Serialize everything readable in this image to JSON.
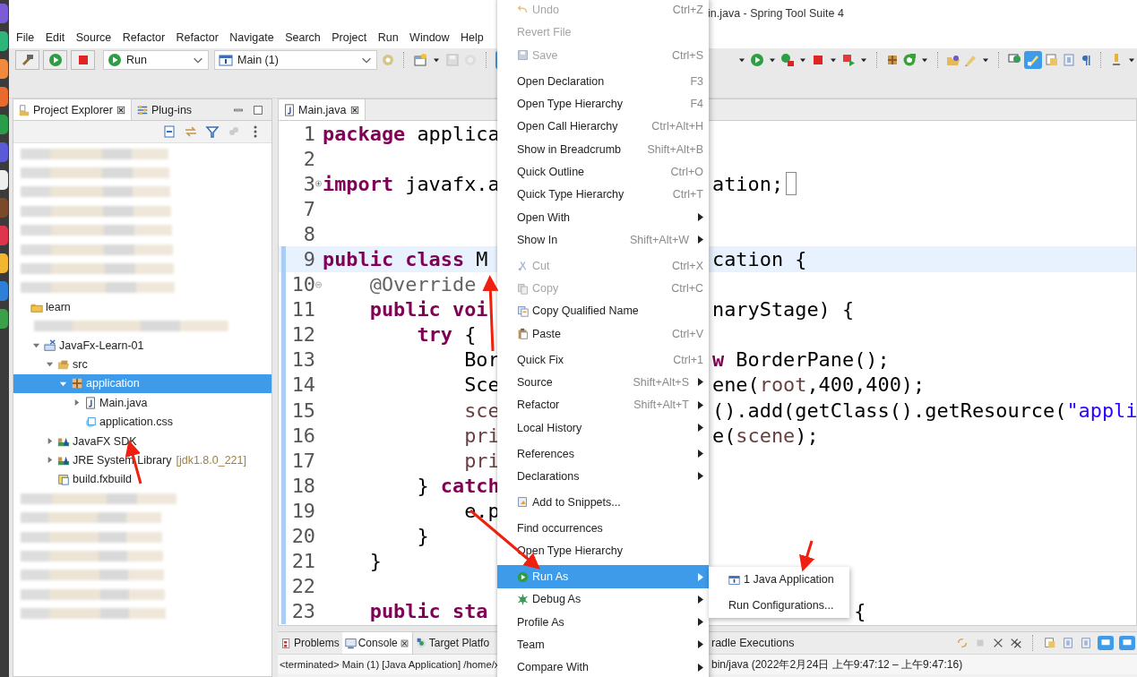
{
  "window": {
    "title": "in.java - Spring Tool Suite 4"
  },
  "menu_bar": [
    "File",
    "Edit",
    "Source",
    "Refactor",
    "Refactor",
    "Navigate",
    "Search",
    "Project",
    "Run",
    "Window",
    "Help"
  ],
  "toolbar": {
    "run_combo": "Run",
    "launch_combo": "Main (1)",
    "toggles": [
      {
        "selected": true
      },
      {
        "selected": true
      }
    ]
  },
  "project_explorer": {
    "tabs": [
      {
        "label": "Project Explorer",
        "selected": true,
        "closable": true
      },
      {
        "label": "Plug-ins",
        "selected": false,
        "closable": false
      }
    ],
    "tree": [
      {
        "kind": "blurred"
      },
      {
        "kind": "blurred"
      },
      {
        "kind": "blurred"
      },
      {
        "kind": "blurred"
      },
      {
        "kind": "blurred"
      },
      {
        "kind": "blurred"
      },
      {
        "kind": "blurred"
      },
      {
        "kind": "blurred"
      },
      {
        "kind": "folder",
        "label": "learn",
        "selected": false,
        "children": [
          {
            "kind": "blurred"
          },
          {
            "kind": "project",
            "label": "JavaFx-Learn-01",
            "expanded": true,
            "selected": false,
            "children": [
              {
                "kind": "source-folder",
                "label": "src",
                "expanded": true,
                "selected": false,
                "children": [
                  {
                    "kind": "package",
                    "label": "application",
                    "expanded": true,
                    "selected": true,
                    "children": [
                      {
                        "kind": "java-file",
                        "label": "Main.java",
                        "expanded": false,
                        "selected": false
                      },
                      {
                        "kind": "css-file",
                        "label": "application.css",
                        "selected": false
                      }
                    ]
                  }
                ]
              },
              {
                "kind": "library",
                "label": "JavaFX SDK",
                "expanded": false,
                "selected": false
              },
              {
                "kind": "library",
                "label": "JRE System Library",
                "decoration": "[jdk1.8.0_221]",
                "expanded": false,
                "selected": false
              },
              {
                "kind": "build-file",
                "label": "build.fxbuild",
                "selected": false
              }
            ]
          }
        ]
      },
      {
        "kind": "blurred"
      },
      {
        "kind": "blurred"
      },
      {
        "kind": "blurred"
      },
      {
        "kind": "blurred"
      },
      {
        "kind": "blurred"
      },
      {
        "kind": "blurred"
      },
      {
        "kind": "blurred"
      }
    ]
  },
  "editor": {
    "tab": {
      "label": "Main.java",
      "closable": true
    },
    "lines": [
      {
        "number": "1",
        "current": false,
        "scope": false,
        "left": [
          {
            "text": "package",
            "kind": "keyword"
          },
          {
            "text": " applica",
            "kind": "plain"
          }
        ]
      },
      {
        "number": "2",
        "current": false,
        "scope": false
      },
      {
        "number": "3",
        "current": false,
        "scope": false,
        "folded": true,
        "left": [
          {
            "text": "import",
            "kind": "keyword"
          },
          {
            "text": " javafx.a",
            "kind": "plain"
          }
        ],
        "right": [
          {
            "text": "ation;",
            "kind": "plain"
          }
        ],
        "bracket_box": true
      },
      {
        "number": "7",
        "current": false,
        "scope": false
      },
      {
        "number": "8",
        "current": false,
        "scope": false
      },
      {
        "number": "9",
        "current": true,
        "scope": true,
        "left": [
          {
            "text": "public class",
            "kind": "keyword"
          },
          {
            "text": " M",
            "kind": "plain"
          }
        ],
        "right": [
          {
            "text": "cation {",
            "kind": "plain"
          }
        ]
      },
      {
        "number": "10",
        "current": false,
        "scope": true,
        "folded": false,
        "left": [
          {
            "text": "    @Override",
            "kind": "annotation"
          }
        ]
      },
      {
        "number": "11",
        "current": false,
        "scope": true,
        "left": [
          {
            "text": "    public voi",
            "kind": "keyword"
          }
        ],
        "right": [
          {
            "text": "naryStage) {",
            "kind": "plain"
          }
        ]
      },
      {
        "number": "12",
        "current": false,
        "scope": true,
        "left": [
          {
            "text": "        try",
            "kind": "keyword"
          },
          {
            "text": " {",
            "kind": "plain"
          }
        ]
      },
      {
        "number": "13",
        "current": false,
        "scope": true,
        "left": [
          {
            "text": "            Bor",
            "kind": "plain"
          }
        ],
        "right": [
          {
            "text": "w",
            "kind": "keyword"
          },
          {
            "text": " BorderPane();",
            "kind": "plain"
          }
        ]
      },
      {
        "number": "14",
        "current": false,
        "scope": true,
        "left": [
          {
            "text": "            Sce",
            "kind": "plain"
          }
        ],
        "right": [
          {
            "text": "ene(",
            "kind": "plain"
          },
          {
            "text": "root",
            "kind": "variable"
          },
          {
            "text": ",400,400);",
            "kind": "plain"
          }
        ]
      },
      {
        "number": "15",
        "current": false,
        "scope": true,
        "left": [
          {
            "text": "            sce",
            "kind": "variable"
          }
        ],
        "right": [
          {
            "text": "().add(getClass().getResource(",
            "kind": "plain"
          },
          {
            "text": "\"appli",
            "kind": "string"
          }
        ]
      },
      {
        "number": "16",
        "current": false,
        "scope": true,
        "left": [
          {
            "text": "            pri",
            "kind": "variable"
          }
        ],
        "right": [
          {
            "text": "e(",
            "kind": "plain"
          },
          {
            "text": "scene",
            "kind": "variable"
          },
          {
            "text": ");",
            "kind": "plain"
          }
        ]
      },
      {
        "number": "17",
        "current": false,
        "scope": true,
        "left": [
          {
            "text": "            pri",
            "kind": "variable"
          }
        ]
      },
      {
        "number": "18",
        "current": false,
        "scope": true,
        "left": [
          {
            "text": "        }",
            "kind": "plain"
          },
          {
            "text": " catch",
            "kind": "keyword"
          }
        ]
      },
      {
        "number": "19",
        "current": false,
        "scope": true,
        "left": [
          {
            "text": "            e.p",
            "kind": "plain"
          }
        ]
      },
      {
        "number": "20",
        "current": false,
        "scope": true,
        "left": [
          {
            "text": "        }",
            "kind": "plain"
          }
        ]
      },
      {
        "number": "21",
        "current": false,
        "scope": true,
        "left": [
          {
            "text": "    }",
            "kind": "plain"
          }
        ]
      },
      {
        "number": "22",
        "current": false,
        "scope": true
      },
      {
        "number": "23",
        "current": false,
        "scope": true,
        "left": [
          {
            "text": "    public sta",
            "kind": "keyword"
          }
        ],
        "right": [
          {
            "text": "            {",
            "kind": "plain"
          }
        ]
      }
    ]
  },
  "context_menu": {
    "items": [
      {
        "kind": "item",
        "label": "Undo",
        "shortcut": "Ctrl+Z",
        "disabled": true,
        "selected": false,
        "submenu": false
      },
      {
        "kind": "item",
        "label": "Revert File",
        "disabled": true,
        "selected": false,
        "submenu": false
      },
      {
        "kind": "item",
        "label": "Save",
        "shortcut": "Ctrl+S",
        "disabled": true,
        "selected": false,
        "submenu": false
      },
      {
        "kind": "separator"
      },
      {
        "kind": "item",
        "label": "Open Declaration",
        "shortcut": "F3",
        "disabled": false,
        "selected": false,
        "submenu": false
      },
      {
        "kind": "item",
        "label": "Open Type Hierarchy",
        "shortcut": "F4",
        "disabled": false,
        "selected": false,
        "submenu": false
      },
      {
        "kind": "item",
        "label": "Open Call Hierarchy",
        "shortcut": "Ctrl+Alt+H",
        "disabled": false,
        "selected": false,
        "submenu": false
      },
      {
        "kind": "item",
        "label": "Show in Breadcrumb",
        "shortcut": "Shift+Alt+B",
        "disabled": false,
        "selected": false,
        "submenu": false
      },
      {
        "kind": "item",
        "label": "Quick Outline",
        "shortcut": "Ctrl+O",
        "disabled": false,
        "selected": false,
        "submenu": false
      },
      {
        "kind": "item",
        "label": "Quick Type Hierarchy",
        "shortcut": "Ctrl+T",
        "disabled": false,
        "selected": false,
        "submenu": false
      },
      {
        "kind": "item",
        "label": "Open With",
        "disabled": false,
        "selected": false,
        "submenu": true
      },
      {
        "kind": "item",
        "label": "Show In",
        "shortcut": "Shift+Alt+W",
        "disabled": false,
        "selected": false,
        "submenu": true
      },
      {
        "kind": "separator"
      },
      {
        "kind": "item",
        "label": "Cut",
        "shortcut": "Ctrl+X",
        "disabled": true,
        "selected": false,
        "submenu": false
      },
      {
        "kind": "item",
        "label": "Copy",
        "shortcut": "Ctrl+C",
        "disabled": true,
        "selected": false,
        "submenu": false
      },
      {
        "kind": "item",
        "label": "Copy Qualified Name",
        "disabled": false,
        "selected": false,
        "submenu": false
      },
      {
        "kind": "item",
        "label": "Paste",
        "shortcut": "Ctrl+V",
        "disabled": false,
        "selected": false,
        "submenu": false
      },
      {
        "kind": "separator"
      },
      {
        "kind": "item",
        "label": "Quick Fix",
        "shortcut": "Ctrl+1",
        "disabled": false,
        "selected": false,
        "submenu": false
      },
      {
        "kind": "item",
        "label": "Source",
        "shortcut": "Shift+Alt+S",
        "disabled": false,
        "selected": false,
        "submenu": true
      },
      {
        "kind": "item",
        "label": "Refactor",
        "shortcut": "Shift+Alt+T",
        "disabled": false,
        "selected": false,
        "submenu": true
      },
      {
        "kind": "item",
        "label": "Local History",
        "disabled": false,
        "selected": false,
        "submenu": true
      },
      {
        "kind": "separator"
      },
      {
        "kind": "item",
        "label": "References",
        "disabled": false,
        "selected": false,
        "submenu": true
      },
      {
        "kind": "item",
        "label": "Declarations",
        "disabled": false,
        "selected": false,
        "submenu": true
      },
      {
        "kind": "separator"
      },
      {
        "kind": "item",
        "label": "Add to Snippets...",
        "disabled": false,
        "selected": false,
        "submenu": false
      },
      {
        "kind": "separator"
      },
      {
        "kind": "item",
        "label": "Find occurrences",
        "disabled": false,
        "selected": false,
        "submenu": false
      },
      {
        "kind": "item",
        "label": "Open Type Hierarchy",
        "disabled": false,
        "selected": false,
        "submenu": false
      },
      {
        "kind": "separator"
      },
      {
        "kind": "item",
        "label": "Run As",
        "disabled": false,
        "selected": true,
        "submenu": true
      },
      {
        "kind": "item",
        "label": "Debug As",
        "disabled": false,
        "selected": false,
        "submenu": true
      },
      {
        "kind": "item",
        "label": "Profile As",
        "disabled": false,
        "selected": false,
        "submenu": true
      },
      {
        "kind": "item",
        "label": "Team",
        "disabled": false,
        "selected": false,
        "submenu": true
      },
      {
        "kind": "item",
        "label": "Compare With",
        "disabled": false,
        "selected": false,
        "submenu": true
      }
    ]
  },
  "submenu": {
    "items": [
      "1 Java Application",
      "Run Configurations..."
    ]
  },
  "bottom_panel": {
    "tabs": [
      {
        "label": "Problems",
        "selected": false,
        "closable": false
      },
      {
        "label": "Console",
        "selected": true,
        "closable": true
      },
      {
        "label": "Target Platfo",
        "selected": false,
        "closable": false
      }
    ],
    "partial_tab": "radle Executions",
    "console_left": "<terminated> Main (1) [Java Application] /home/x",
    "console_right": "bin/java  (2022年2月24日 上午9:47:12 – 上午9:47:16)",
    "toggles": [
      {
        "selected": true
      },
      {
        "selected": true
      }
    ]
  }
}
